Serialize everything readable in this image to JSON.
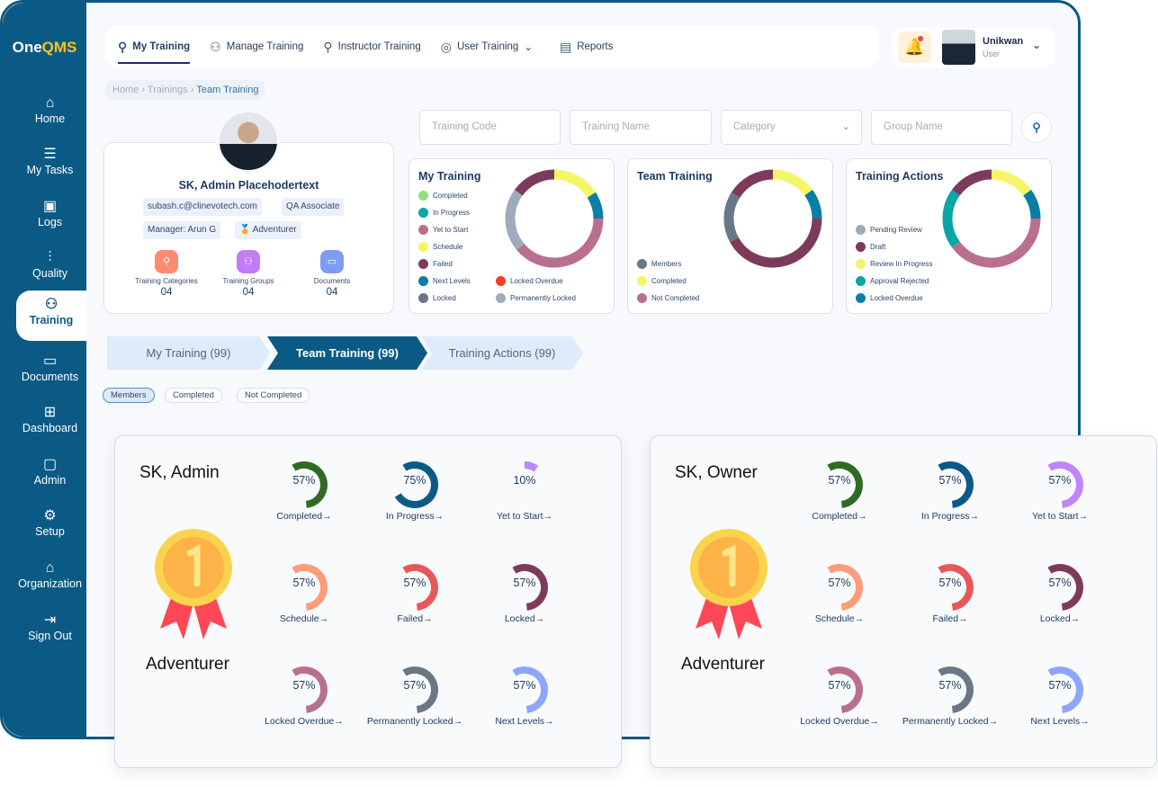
{
  "app": {
    "logo_a": "One",
    "logo_b": "QMS"
  },
  "sidebar": {
    "items": [
      {
        "label": "Home",
        "icon": "home-icon",
        "glyph": "⌂"
      },
      {
        "label": "My Tasks",
        "icon": "list-icon",
        "glyph": "☰"
      },
      {
        "label": "Logs",
        "icon": "terminal-icon",
        "glyph": "▣"
      },
      {
        "label": "Quality",
        "icon": "bar-chart-icon",
        "glyph": "⫶"
      },
      {
        "label": "Training",
        "icon": "users-icon",
        "glyph": "⚇",
        "active": true
      },
      {
        "label": "Documents",
        "icon": "folder-icon",
        "glyph": "▭"
      },
      {
        "label": "Dashboard",
        "icon": "grid-icon",
        "glyph": "⊞"
      },
      {
        "label": "Admin",
        "icon": "monitor-icon",
        "glyph": "▢"
      },
      {
        "label": "Setup",
        "icon": "gear-icon",
        "glyph": "⚙"
      },
      {
        "label": "Organization",
        "icon": "bank-icon",
        "glyph": "⌂"
      },
      {
        "label": "Sign Out",
        "icon": "sign-out-icon",
        "glyph": "⇥"
      }
    ]
  },
  "topnav": {
    "items": [
      {
        "label": "My Training",
        "icon": "user-up-icon",
        "glyph": "⚲",
        "active": true
      },
      {
        "label": "Manage Training",
        "icon": "users-settings-icon",
        "glyph": "⚇"
      },
      {
        "label": "Instructor Training",
        "icon": "instructor-icon",
        "glyph": "⚲"
      },
      {
        "label": "User Training",
        "icon": "user-circle-icon",
        "glyph": "◎",
        "dropdown": "⌄"
      },
      {
        "label": "Reports",
        "icon": "report-icon",
        "glyph": "▤"
      }
    ]
  },
  "user": {
    "name": "Unikwan",
    "role": "User"
  },
  "breadcrumb": [
    "Home",
    "Trainings",
    "Team Training"
  ],
  "profile": {
    "name": "SK, Admin Placehodertext",
    "email": "subash.c@clinevotech.com",
    "title": "QA Associate",
    "manager": "Manager: Arun G",
    "rank": "Adventurer",
    "stats": [
      {
        "label": "Training Categories",
        "value": "04",
        "color": "#ff8a70"
      },
      {
        "label": "Training Groups",
        "value": "04",
        "color": "#c27cf5"
      },
      {
        "label": "Documents",
        "value": "04",
        "color": "#7f9cf5"
      }
    ]
  },
  "filters": {
    "training_code": "Training Code",
    "training_name": "Training Name",
    "category": "Category",
    "group_name": "Group Name"
  },
  "charts": [
    {
      "title": "My Training",
      "legend": [
        {
          "label": "Completed",
          "color": "#8fe07a"
        },
        {
          "label": "In Progress",
          "color": "#0aa5a5"
        },
        {
          "label": "Yet to Start",
          "color": "#b9708f"
        },
        {
          "label": "Schedule",
          "color": "#f5f56a"
        },
        {
          "label": "Failed",
          "color": "#7d3b5b"
        },
        {
          "label": "Next Levels",
          "color": "#0a7ea4"
        },
        {
          "label": "Locked",
          "color": "#6b7787"
        },
        {
          "label": "Locked Overdue",
          "color": "#f5392a"
        },
        {
          "label": "Permanently Locked",
          "color": "#9eabbc"
        }
      ],
      "segments": [
        {
          "value": 16,
          "color": "#f5f56a"
        },
        {
          "value": 9,
          "color": "#0a7ea4"
        },
        {
          "value": 39,
          "color": "#b9708f"
        },
        {
          "value": 21,
          "color": "#9eabbc"
        },
        {
          "value": 15,
          "color": "#7d3b5b"
        }
      ]
    },
    {
      "title": "Team Training",
      "legend": [
        {
          "label": "Members",
          "color": "#6b7787"
        },
        {
          "label": "Completed",
          "color": "#f5f56a"
        },
        {
          "label": "Not Completed",
          "color": "#b9708f"
        }
      ],
      "segments": [
        {
          "value": 15,
          "color": "#f5f56a"
        },
        {
          "value": 10,
          "color": "#0a7ea4"
        },
        {
          "value": 42,
          "color": "#7d3b5b"
        },
        {
          "value": 17,
          "color": "#6b7787"
        },
        {
          "value": 16,
          "color": "#7d3b5b"
        }
      ]
    },
    {
      "title": "Training Actions",
      "legend": [
        {
          "label": "Pending Review",
          "color": "#9eabbc"
        },
        {
          "label": "Draft",
          "color": "#7d3b5b"
        },
        {
          "label": "Review In Progress",
          "color": "#f5f56a"
        },
        {
          "label": "Approval Rejected",
          "color": "#0aa5a5"
        },
        {
          "label": "Locked Overdue",
          "color": "#0a7ea4"
        }
      ],
      "segments": [
        {
          "value": 15,
          "color": "#f5f56a"
        },
        {
          "value": 10,
          "color": "#0a7ea4"
        },
        {
          "value": 40,
          "color": "#b9708f"
        },
        {
          "value": 20,
          "color": "#0aa5a5"
        },
        {
          "value": 15,
          "color": "#7d3b5b"
        }
      ]
    }
  ],
  "tabs": [
    "My Training (99)",
    "Team Training (99)",
    "Training Actions (99)"
  ],
  "chips": [
    "Members",
    "Completed",
    "Not Completed"
  ],
  "members": [
    {
      "name": "SK, Admin",
      "rank": "Adventurer",
      "gauges": [
        {
          "label": "Completed",
          "pct": 57,
          "color": "#2f6b24"
        },
        {
          "label": "In Progress",
          "pct": 75,
          "color": "#0b5a85"
        },
        {
          "label": "Yet to Start",
          "pct": 10,
          "color": "#c084fc"
        },
        {
          "label": "Schedule",
          "pct": 57,
          "color": "#ff9a7a"
        },
        {
          "label": "Failed",
          "pct": 57,
          "color": "#e85858"
        },
        {
          "label": "Locked",
          "pct": 57,
          "color": "#7d3b5b"
        },
        {
          "label": "Locked Overdue",
          "pct": 57,
          "color": "#b9708f"
        },
        {
          "label": "Permanently Locked",
          "pct": 57,
          "color": "#6b7787"
        },
        {
          "label": "Next Levels",
          "pct": 57,
          "color": "#8ea5ff"
        }
      ]
    },
    {
      "name": "SK, Owner",
      "rank": "Adventurer",
      "gauges": [
        {
          "label": "Completed",
          "pct": 57,
          "color": "#2f6b24"
        },
        {
          "label": "In Progress",
          "pct": 57,
          "color": "#0b5a85"
        },
        {
          "label": "Yet to Start",
          "pct": 57,
          "color": "#c084fc"
        },
        {
          "label": "Schedule",
          "pct": 57,
          "color": "#ff9a7a"
        },
        {
          "label": "Failed",
          "pct": 57,
          "color": "#e85858"
        },
        {
          "label": "Locked",
          "pct": 57,
          "color": "#7d3b5b"
        },
        {
          "label": "Locked Overdue",
          "pct": 57,
          "color": "#b9708f"
        },
        {
          "label": "Permanently Locked",
          "pct": 57,
          "color": "#6b7787"
        },
        {
          "label": "Next Levels",
          "pct": 57,
          "color": "#8ea5ff"
        }
      ]
    }
  ]
}
